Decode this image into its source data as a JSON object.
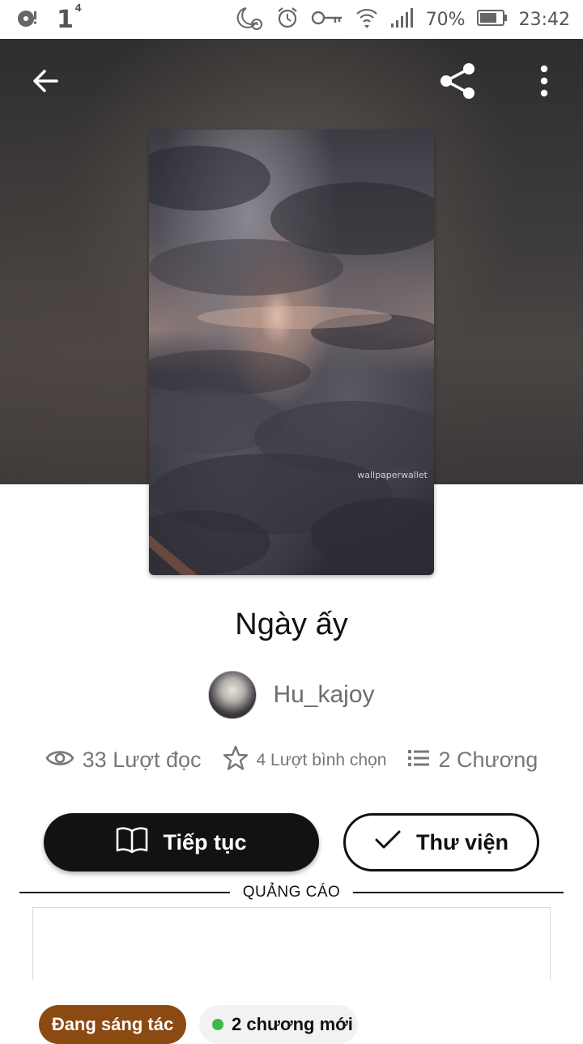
{
  "status_bar": {
    "notif_count": "1",
    "notif_sup": "4",
    "battery": "70%",
    "time": "23:42"
  },
  "toolbar": {
    "back_icon": "arrow-left-icon",
    "share_icon": "share-icon",
    "menu_icon": "more-vertical-icon"
  },
  "cover": {
    "watermark": "wallpaperwallet"
  },
  "story": {
    "title": "Ngày ấy",
    "author": "Hu_kajoy"
  },
  "stats": {
    "reads": "33 Lượt đọc",
    "votes": "4 Lượt bình chọn",
    "chapters": "2 Chương"
  },
  "actions": {
    "continue_label": "Tiếp tục",
    "library_label": "Thư viện"
  },
  "ad": {
    "label": "QUẢNG CÁO"
  },
  "badges": {
    "status": "Đang sáng tác",
    "new_chapters": "2 chương mới"
  },
  "colors": {
    "primary_dark": "#121212",
    "status_badge": "#8a4a12",
    "new_dot": "#3db94c"
  }
}
